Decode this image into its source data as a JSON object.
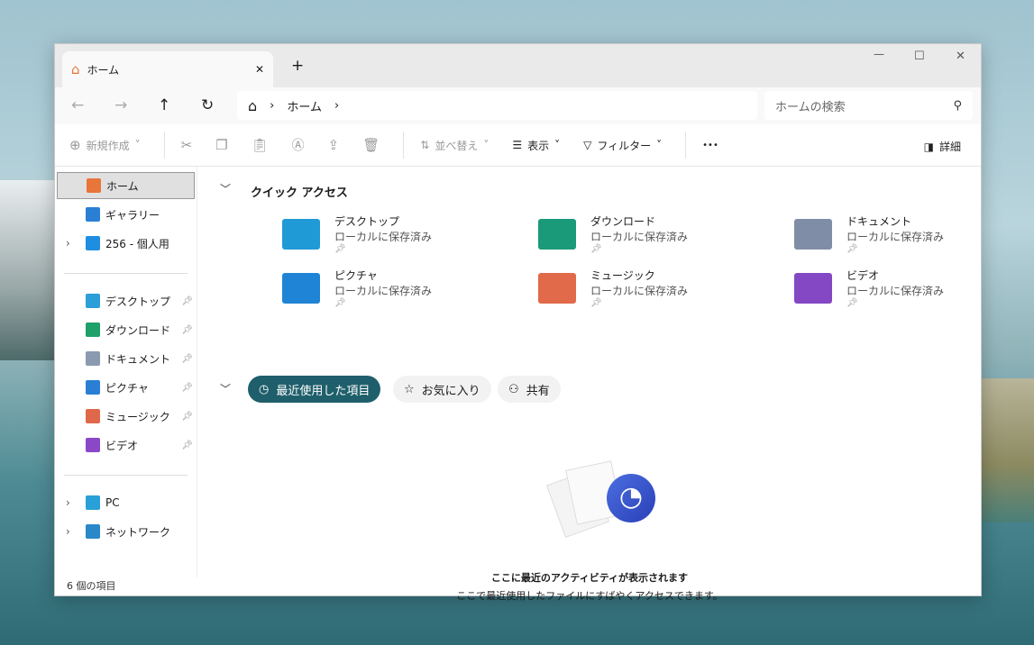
{
  "window": {
    "tab_title": "ホーム",
    "new_tab": "+",
    "minimize": "—",
    "maximize": "☐",
    "close": "✕"
  },
  "nav": {
    "back": "←",
    "forward": "→",
    "up": "↑",
    "refresh": "↻",
    "path": [
      "ホーム"
    ],
    "search_placeholder": "ホームの検索"
  },
  "toolbar": {
    "new": "新規作成",
    "sort": "並べ替え",
    "view": "表示",
    "filter": "フィルター",
    "more": "•••",
    "details": "詳細"
  },
  "sidebar": {
    "top": [
      {
        "label": "ホーム",
        "icon": "home-icon",
        "color": "#e8753a"
      },
      {
        "label": "ギャラリー",
        "icon": "gallery-icon",
        "color": "#2a7fd4"
      },
      {
        "label": "256 - 個人用",
        "icon": "onedrive-icon",
        "color": "#1e8ee0"
      }
    ],
    "pinned": [
      {
        "label": "デスクトップ",
        "icon": "desktop-icon",
        "color": "#2a9fd8"
      },
      {
        "label": "ダウンロード",
        "icon": "download-icon",
        "color": "#1ea06a"
      },
      {
        "label": "ドキュメント",
        "icon": "document-icon",
        "color": "#8a9ab0"
      },
      {
        "label": "ピクチャ",
        "icon": "pictures-icon",
        "color": "#2a7fd4"
      },
      {
        "label": "ミュージック",
        "icon": "music-icon",
        "color": "#e0684a"
      },
      {
        "label": "ビデオ",
        "icon": "video-icon",
        "color": "#8a48c8"
      }
    ],
    "bottom": [
      {
        "label": "PC",
        "icon": "pc-icon",
        "color": "#2aa0d8"
      },
      {
        "label": "ネットワーク",
        "icon": "network-icon",
        "color": "#2a88c8"
      }
    ]
  },
  "quick_access": {
    "title": "クイック アクセス",
    "items": [
      {
        "name": "デスクトップ",
        "sub": "ローカルに保存済み",
        "color": "#1f9ad6"
      },
      {
        "name": "ダウンロード",
        "sub": "ローカルに保存済み",
        "color": "#1a9a78"
      },
      {
        "name": "ドキュメント",
        "sub": "ローカルに保存済み",
        "color": "#7f8ea6"
      },
      {
        "name": "ピクチャ",
        "sub": "ローカルに保存済み",
        "color": "#1f84d6"
      },
      {
        "name": "ミュージック",
        "sub": "ローカルに保存済み",
        "color": "#e06a4a"
      },
      {
        "name": "ビデオ",
        "sub": "ローカルに保存済み",
        "color": "#8448c4"
      }
    ]
  },
  "recent": {
    "tabs": [
      "最近使用した項目",
      "お気に入り",
      "共有"
    ],
    "accent": "#1f5f6b",
    "empty_title": "ここに最近のアクティビティが表示されます",
    "empty_sub": "ここで最近使用したファイルにすばやくアクセスできます。"
  },
  "status": {
    "count": "6 個の項目"
  }
}
